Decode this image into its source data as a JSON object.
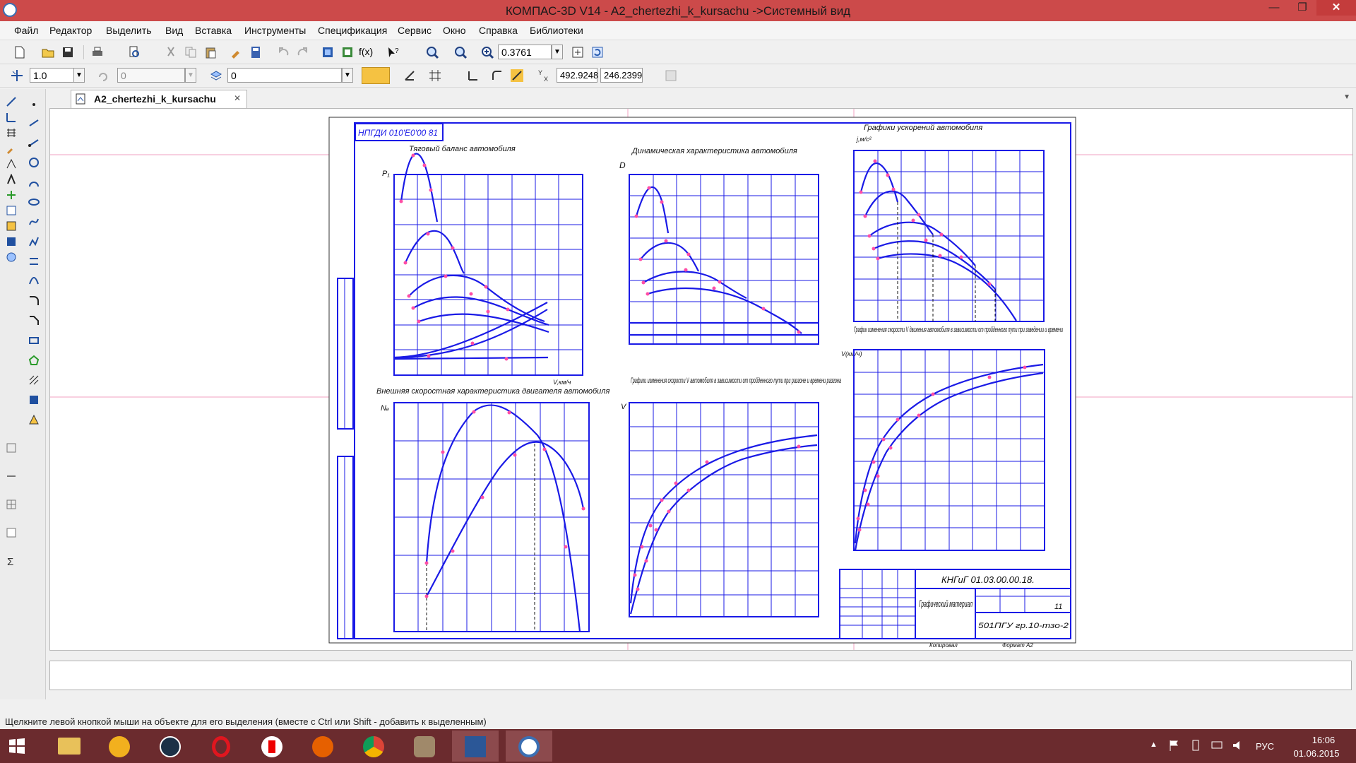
{
  "window": {
    "title": "КОМПАС-3D V14 - A2_chertezhi_k_kursachu ->Системный вид",
    "minimize": "—",
    "maximize": "❐",
    "close": "✕"
  },
  "menu": [
    "Файл",
    "Редактор",
    "Выделить",
    "Вид",
    "Вставка",
    "Инструменты",
    "Спецификация",
    "Сервис",
    "Окно",
    "Справка",
    "Библиотеки"
  ],
  "toolbar1": {
    "zoom_value": "0.3761",
    "fx_label": "f(x)"
  },
  "toolbar2": {
    "step_value": "1.0",
    "angle_value": "0",
    "layer_value": "0",
    "coord_x": "492.9248",
    "coord_y": "246.2399"
  },
  "tab": {
    "label": "A2_chertezhi_k_kursachu",
    "close": "✕"
  },
  "drawing": {
    "stamp_code": "НПГДИ 010'E0'00 81",
    "titles": {
      "traction": "Тяговый баланс автомобиля",
      "dynamic": "Динамическая характеристика автомобиля",
      "accel": "Графики ускорений автомобиля",
      "engine": "Внешняя скоростная характеристика двигателя автомобиля",
      "speed_path": "Графики изменения скорости V автомобиля в зависимости от пройденного пути при разгоне и времени разгона",
      "speed_time": "График изменения скорости V движения автомобиля в зависимости от пройденного пути при заведении и времени"
    },
    "labels": {
      "Pk": "P₁",
      "D": "D",
      "j": "j,м/с²",
      "Ne": "Nₑ",
      "V": "V",
      "Vkm": "V,км/ч",
      "Vkm2": "V(км/ч)"
    },
    "titleblock": {
      "code": "КНГиГ 01.03.00.00.18.",
      "name": "Графический материал",
      "sheet": "11",
      "org": "501ПГУ гр.10-тзо-2",
      "format": "Формат  А2",
      "copied": "Копировал"
    }
  },
  "statusbar": "Щелкните левой кнопкой мыши на объекте для его выделения (вместе с Ctrl или Shift - добавить к выделенным)",
  "taskbar": {
    "apps": [
      "file-explorer",
      "archicad",
      "steam",
      "opera",
      "yandex",
      "firefox",
      "chrome",
      "game",
      "word",
      "kompas"
    ],
    "lang": "РУС",
    "time": "16:06",
    "date": "01.06.2015"
  },
  "colors": {
    "titlebar": "#cc4a4a",
    "taskbar": "#6b2b2e",
    "drawing_line": "#1a1ae6",
    "point": "#ff4da6"
  }
}
